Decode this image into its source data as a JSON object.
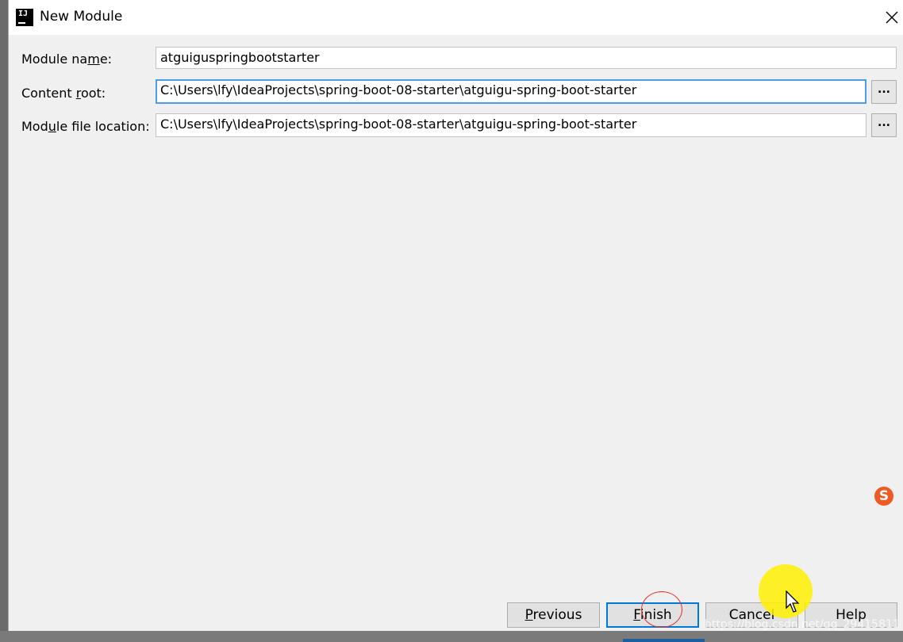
{
  "window": {
    "title": "New Module",
    "close_label": "×"
  },
  "form": {
    "module_name": {
      "label_before": "Module na",
      "label_mnemonic": "m",
      "label_after": "e:",
      "value": "atguiguspringbootstarter"
    },
    "content_root": {
      "label_before": "Content ",
      "label_mnemonic": "r",
      "label_after": "oot:",
      "value": "C:\\Users\\lfy\\IdeaProjects\\spring-boot-08-starter\\atguigu-spring-boot-starter",
      "browse_label": "..."
    },
    "module_file_location": {
      "label_before": "Mod",
      "label_mnemonic": "u",
      "label_after": "le file location:",
      "value": "C:\\Users\\lfy\\IdeaProjects\\spring-boot-08-starter\\atguigu-spring-boot-starter",
      "browse_label": "..."
    }
  },
  "buttons": {
    "previous": {
      "mnemonic": "P",
      "rest": "revious"
    },
    "finish": {
      "mnemonic": "F",
      "rest": "inish"
    },
    "cancel": {
      "label": "Cancel"
    },
    "help": {
      "label": "Help"
    }
  },
  "overlay": {
    "ime_label": "S",
    "watermark": "https://blog.csdn.net/qq_29415811"
  },
  "colors": {
    "focus_border": "#4e9dea",
    "default_button_border": "#0078d7",
    "cursor_highlight": "#fff000",
    "ime_icon": "#ee5a24"
  }
}
